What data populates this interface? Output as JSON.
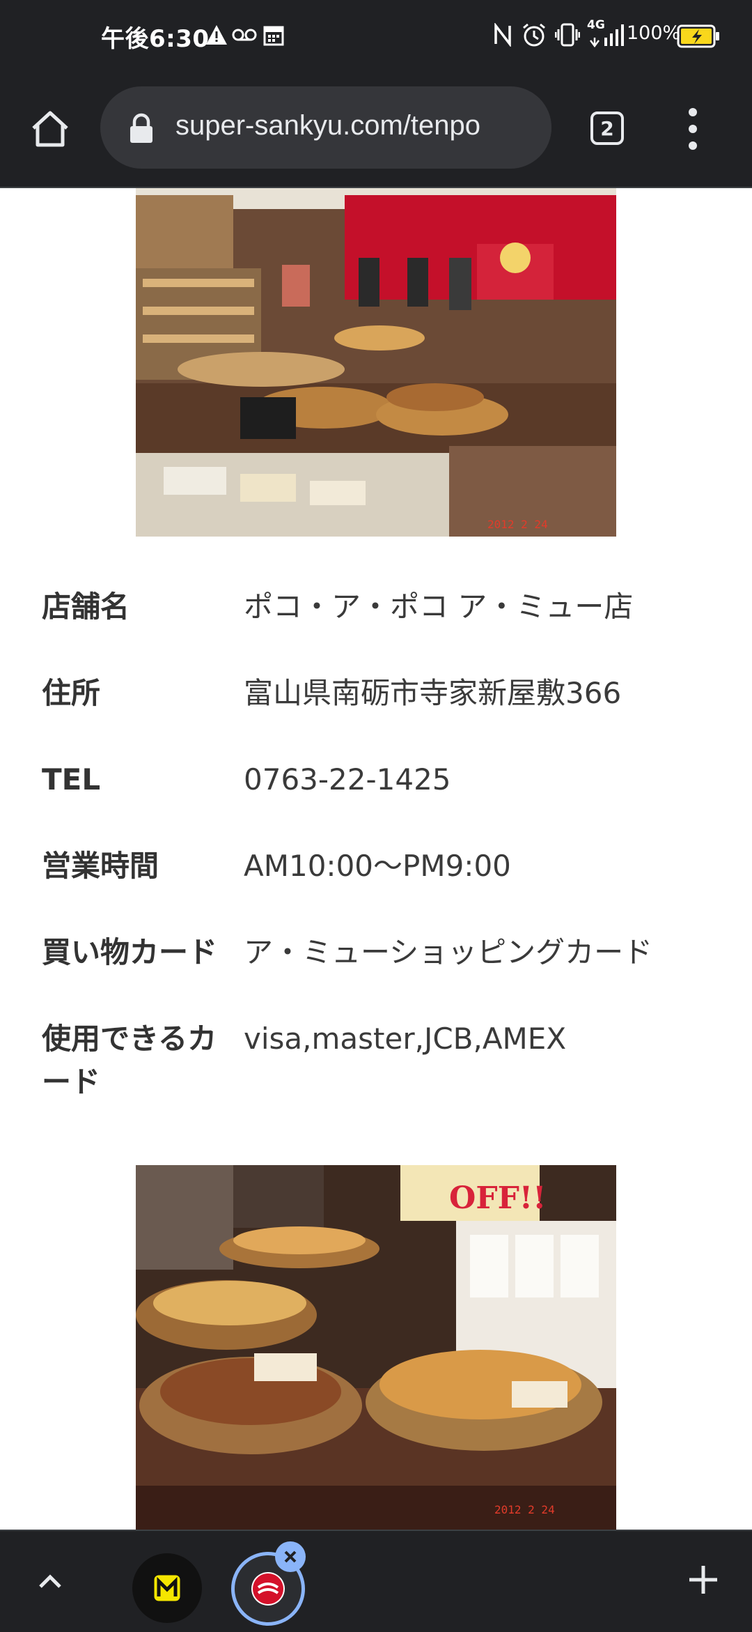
{
  "status_bar": {
    "time": "午後6:30",
    "network": "4G",
    "battery": "100%",
    "icons": [
      "warning-icon",
      "voicemail-icon",
      "calendar-icon",
      "nfc-icon",
      "alarm-icon",
      "vibrate-icon",
      "signal-icon",
      "battery-charging-icon"
    ]
  },
  "toolbar": {
    "url": "super-sankyu.com/tenpo",
    "tab_count": "2"
  },
  "store": {
    "rows": [
      {
        "label": "店舗名",
        "value": "ポコ・ア・ポコ ア・ミュー店"
      },
      {
        "label": "住所",
        "value": "富山県南砺市寺家新屋敷366"
      },
      {
        "label": "TEL",
        "value": "0763-22-1425"
      },
      {
        "label": "営業時間",
        "value": "AM10:00〜PM9:00"
      },
      {
        "label": "買い物カード",
        "value": "ア・ミューショッピングカード"
      },
      {
        "label": "使用できるカード",
        "value": "visa,master,JCB,AMEX"
      }
    ]
  },
  "photos": {
    "top_stamp": "2012 2 24",
    "bottom_stamp": "2012 2 24",
    "bottom_sign": "OFF!!"
  },
  "colors": {
    "chrome_bg": "#202124",
    "url_bar_bg": "#35363a",
    "accent_blue": "#8ab4f8",
    "store_red": "#c4102a"
  }
}
